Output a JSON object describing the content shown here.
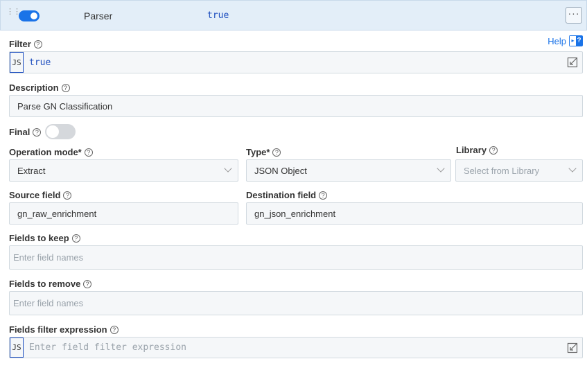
{
  "header": {
    "name": "Parser",
    "filter_value": "true",
    "more_label": "···"
  },
  "help": {
    "label": "Help"
  },
  "filter": {
    "label": "Filter",
    "js_tag": "JS",
    "value": "true"
  },
  "description": {
    "label": "Description",
    "value": "Parse GN Classification"
  },
  "final": {
    "label": "Final"
  },
  "operation_mode": {
    "label": "Operation mode*",
    "value": "Extract"
  },
  "type": {
    "label": "Type*",
    "value": "JSON Object"
  },
  "library": {
    "label": "Library",
    "placeholder": "Select from Library"
  },
  "source_field": {
    "label": "Source field",
    "value": "gn_raw_enrichment"
  },
  "destination_field": {
    "label": "Destination field",
    "value": "gn_json_enrichment"
  },
  "fields_to_keep": {
    "label": "Fields to keep",
    "placeholder": "Enter field names"
  },
  "fields_to_remove": {
    "label": "Fields to remove",
    "placeholder": "Enter field names"
  },
  "fields_filter_expression": {
    "label": "Fields filter expression",
    "js_tag": "JS",
    "placeholder": "Enter field filter expression"
  },
  "icons": {
    "drag": "drag-handle-icon",
    "help": "help-icon",
    "question": "question-circle-icon",
    "chevron": "chevron-down-icon",
    "expand": "expand-editor-icon"
  },
  "colors": {
    "accent": "#1a73e8",
    "header_bg": "#e3eef8",
    "field_bg": "#f5f7f9",
    "code_text": "#1f4fbf"
  }
}
